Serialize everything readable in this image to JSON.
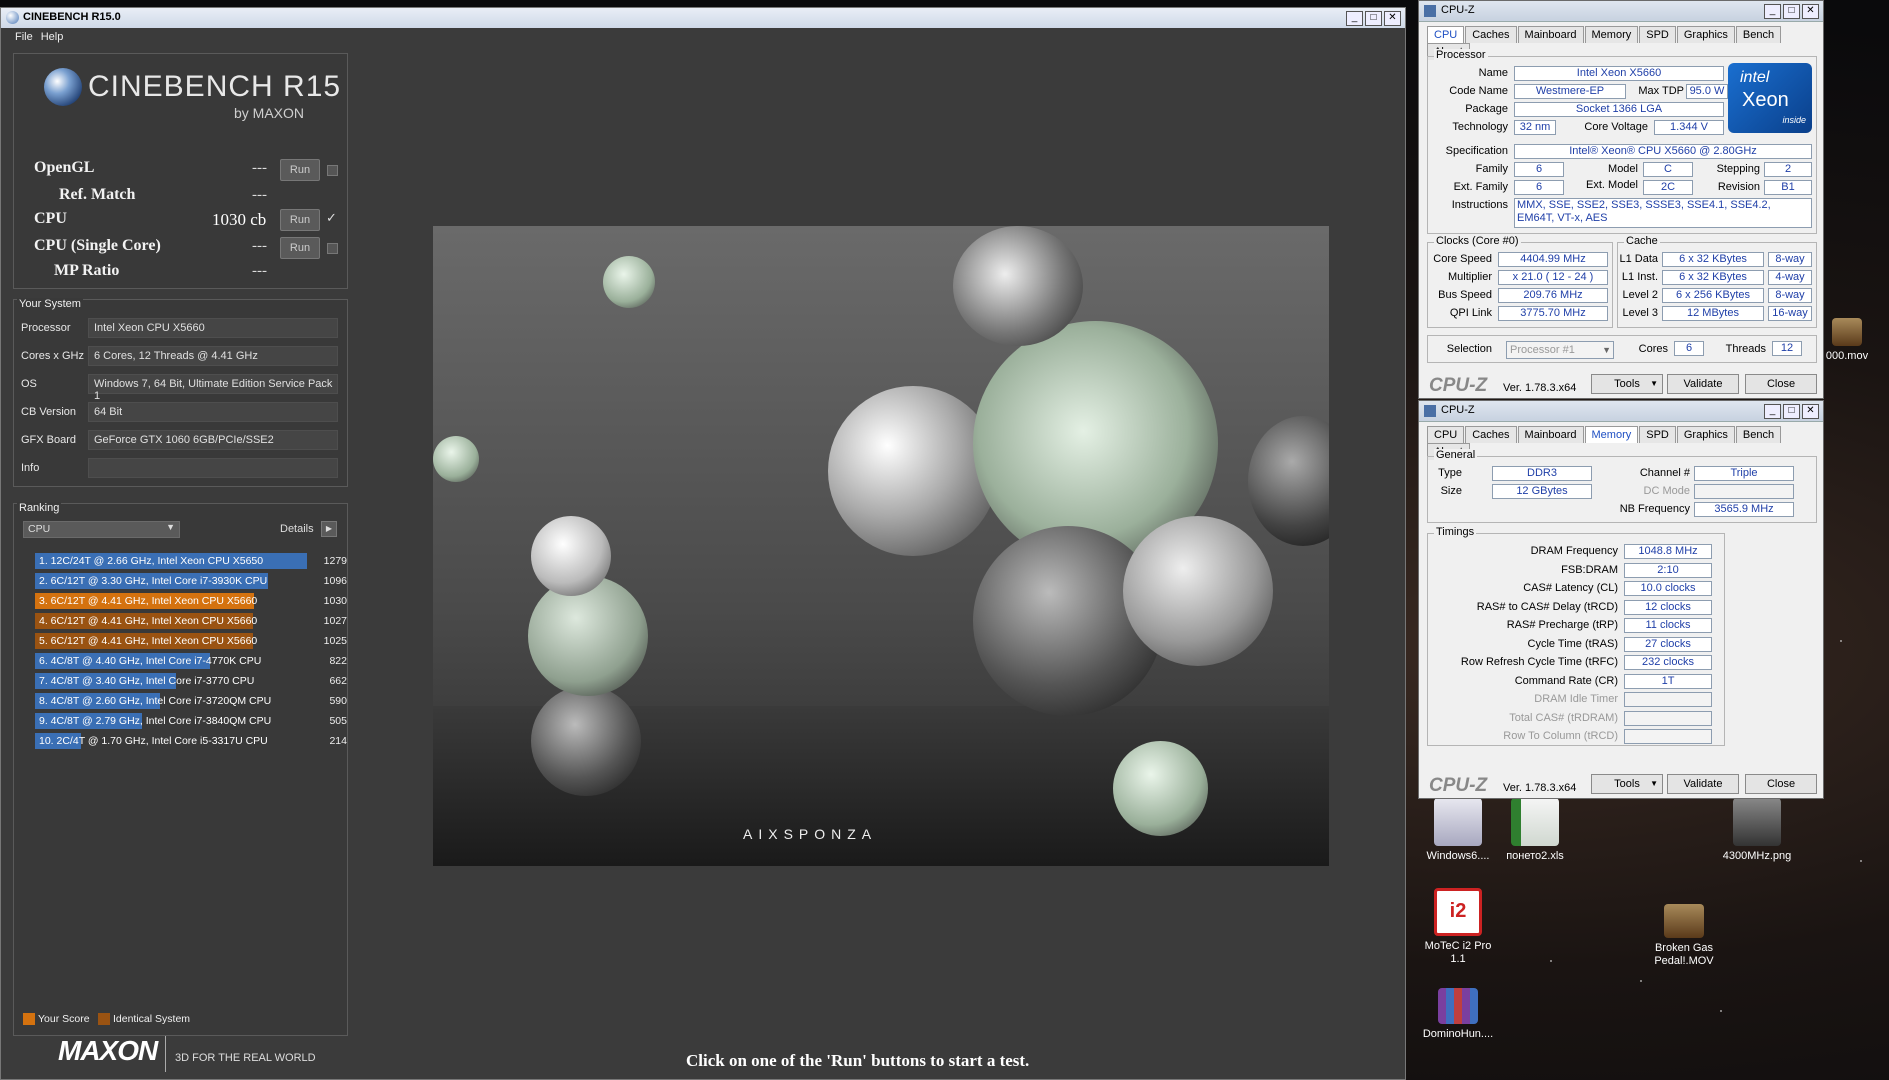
{
  "cinebench": {
    "title": "CINEBENCH R15.0",
    "menu": [
      "File",
      "Help"
    ],
    "logo": {
      "name": "CINEBENCH R15",
      "sub": "by MAXON"
    },
    "tests": [
      {
        "label": "OpenGL",
        "value": "---",
        "button": "Run",
        "checked": false
      },
      {
        "label": "Ref. Match",
        "value": "---"
      },
      {
        "label": "CPU",
        "value": "1030 cb",
        "button": "Run",
        "checked": true
      },
      {
        "label": "CPU (Single Core)",
        "value": "---",
        "button": "Run",
        "checked": false
      },
      {
        "label": "MP Ratio",
        "value": "---"
      }
    ],
    "system_title": "Your System",
    "system": [
      {
        "k": "Processor",
        "v": "Intel Xeon CPU X5660"
      },
      {
        "k": "Cores x GHz",
        "v": "6 Cores, 12 Threads @ 4.41 GHz"
      },
      {
        "k": "OS",
        "v": "Windows 7, 64 Bit, Ultimate Edition Service Pack 1"
      },
      {
        "k": "CB Version",
        "v": "64 Bit"
      },
      {
        "k": "GFX Board",
        "v": "GeForce GTX 1060 6GB/PCIe/SSE2"
      },
      {
        "k": "Info",
        "v": ""
      }
    ],
    "ranking_title": "Ranking",
    "ranking_select": "CPU",
    "details_label": "Details",
    "ranking": [
      {
        "label": "1. 12C/24T @ 2.66 GHz, Intel Xeon CPU X5650",
        "score": 1279,
        "kind": "blue"
      },
      {
        "label": "2. 6C/12T @ 3.30 GHz,  Intel Core i7-3930K CPU",
        "score": 1096,
        "kind": "blue"
      },
      {
        "label": "3. 6C/12T @ 4.41 GHz, Intel Xeon CPU X5660",
        "score": 1030,
        "kind": "your"
      },
      {
        "label": "4. 6C/12T @ 4.41 GHz, Intel Xeon CPU X5660",
        "score": 1027,
        "kind": "ident"
      },
      {
        "label": "5. 6C/12T @ 4.41 GHz, Intel Xeon CPU X5660",
        "score": 1025,
        "kind": "ident"
      },
      {
        "label": "6. 4C/8T @ 4.40 GHz, Intel Core i7-4770K CPU",
        "score": 822,
        "kind": "blue"
      },
      {
        "label": "7. 4C/8T @ 3.40 GHz,  Intel Core i7-3770 CPU",
        "score": 662,
        "kind": "blue"
      },
      {
        "label": "8. 4C/8T @ 2.60 GHz, Intel Core i7-3720QM CPU",
        "score": 590,
        "kind": "blue"
      },
      {
        "label": "9. 4C/8T @ 2.79 GHz,  Intel Core i7-3840QM CPU",
        "score": 505,
        "kind": "blue"
      },
      {
        "label": "10. 2C/4T @ 1.70 GHz,  Intel Core i5-3317U CPU",
        "score": 214,
        "kind": "blue"
      }
    ],
    "legend": {
      "your": "Your Score",
      "ident": "Identical System"
    },
    "footer": {
      "brand": "MAXON",
      "tagline": "3D FOR THE REAL WORLD"
    },
    "status": "Click on one of the 'Run' buttons to start a test.",
    "render_logo": "AIXSPONZA",
    "colors": {
      "blue": "#3a6fb5",
      "your": "#d4720f",
      "ident": "#9a5312"
    }
  },
  "cpuz1": {
    "title": "CPU-Z",
    "tabs": [
      "CPU",
      "Caches",
      "Mainboard",
      "Memory",
      "SPD",
      "Graphics",
      "Bench",
      "About"
    ],
    "active_tab": "CPU",
    "processor_label": "Processor",
    "name_k": "Name",
    "name": "Intel Xeon X5660",
    "codename_k": "Code Name",
    "codename": "Westmere-EP",
    "tdp_k": "Max TDP",
    "tdp": "95.0 W",
    "package_k": "Package",
    "package": "Socket 1366 LGA",
    "tech_k": "Technology",
    "tech": "32 nm",
    "voltage_k": "Core Voltage",
    "voltage": "1.344 V",
    "spec_k": "Specification",
    "spec": "Intel® Xeon® CPU        X5660  @ 2.80GHz",
    "family_k": "Family",
    "family": "6",
    "model_k": "Model",
    "model": "C",
    "stepping_k": "Stepping",
    "stepping": "2",
    "extfamily_k": "Ext. Family",
    "extfamily": "6",
    "extmodel_k": "Ext. Model",
    "extmodel": "2C",
    "revision_k": "Revision",
    "revision": "B1",
    "instr_k": "Instructions",
    "instr": "MMX, SSE, SSE2, SSE3, SSSE3, SSE4.1, SSE4.2, EM64T, VT-x, AES",
    "clocks_label": "Clocks (Core #0)",
    "corespeed_k": "Core Speed",
    "corespeed": "4404.99 MHz",
    "mult_k": "Multiplier",
    "mult": "x 21.0  ( 12 - 24 )",
    "bus_k": "Bus Speed",
    "bus": "209.76 MHz",
    "qpi_k": "QPI Link",
    "qpi": "3775.70 MHz",
    "cache_label": "Cache",
    "l1d_k": "L1 Data",
    "l1d": "6 x 32 KBytes",
    "l1d_w": "8-way",
    "l1i_k": "L1 Inst.",
    "l1i": "6 x 32 KBytes",
    "l1i_w": "4-way",
    "l2_k": "Level 2",
    "l2": "6 x 256 KBytes",
    "l2_w": "8-way",
    "l3_k": "Level 3",
    "l3": "12 MBytes",
    "l3_w": "16-way",
    "selection_k": "Selection",
    "selection": "Processor #1",
    "cores_k": "Cores",
    "cores": "6",
    "threads_k": "Threads",
    "threads": "12",
    "brand": "CPU-Z",
    "version": "Ver. 1.78.3.x64",
    "tools": "Tools",
    "validate": "Validate",
    "close": "Close",
    "intel_logo": {
      "top": "intel",
      "mid": "Xeon",
      "bot": "inside"
    }
  },
  "cpuz2": {
    "title": "CPU-Z",
    "tabs": [
      "CPU",
      "Caches",
      "Mainboard",
      "Memory",
      "SPD",
      "Graphics",
      "Bench",
      "About"
    ],
    "active_tab": "Memory",
    "general_label": "General",
    "type_k": "Type",
    "type": "DDR3",
    "size_k": "Size",
    "size": "12 GBytes",
    "channel_k": "Channel #",
    "channel": "Triple",
    "dcmode_k": "DC Mode",
    "dcmode": "",
    "nbfreq_k": "NB Frequency",
    "nbfreq": "3565.9 MHz",
    "timings_label": "Timings",
    "timings": [
      {
        "k": "DRAM Frequency",
        "v": "1048.8 MHz",
        "dis": false
      },
      {
        "k": "FSB:DRAM",
        "v": "2:10",
        "dis": false
      },
      {
        "k": "CAS# Latency (CL)",
        "v": "10.0 clocks",
        "dis": false
      },
      {
        "k": "RAS# to CAS# Delay (tRCD)",
        "v": "12 clocks",
        "dis": false
      },
      {
        "k": "RAS# Precharge (tRP)",
        "v": "11 clocks",
        "dis": false
      },
      {
        "k": "Cycle Time (tRAS)",
        "v": "27 clocks",
        "dis": false
      },
      {
        "k": "Row Refresh Cycle Time (tRFC)",
        "v": "232 clocks",
        "dis": false
      },
      {
        "k": "Command Rate (CR)",
        "v": "1T",
        "dis": false
      },
      {
        "k": "DRAM Idle Timer",
        "v": "",
        "dis": true
      },
      {
        "k": "Total CAS# (tRDRAM)",
        "v": "",
        "dis": true
      },
      {
        "k": "Row To Column (tRCD)",
        "v": "",
        "dis": true
      }
    ],
    "brand": "CPU-Z",
    "version": "Ver. 1.78.3.x64",
    "tools": "Tools",
    "validate": "Validate",
    "close": "Close"
  },
  "desktop": {
    "icons": [
      {
        "label": "Windows6....",
        "color": "#c8c8d8"
      },
      {
        "label": "понето2.xls",
        "color": "#3f8f3f"
      },
      {
        "label": "4300MHz.png",
        "color": "#555"
      },
      {
        "label": "MoTeC i2 Pro 1.1",
        "color": "#c22"
      },
      {
        "label": "Broken Gas Pedal!.MOV",
        "color": "#8a6a3a"
      },
      {
        "label": "DominoHun....",
        "color": "#6b3f8f"
      },
      {
        "label": "000.mov",
        "color": "#8a6a3a"
      }
    ]
  }
}
